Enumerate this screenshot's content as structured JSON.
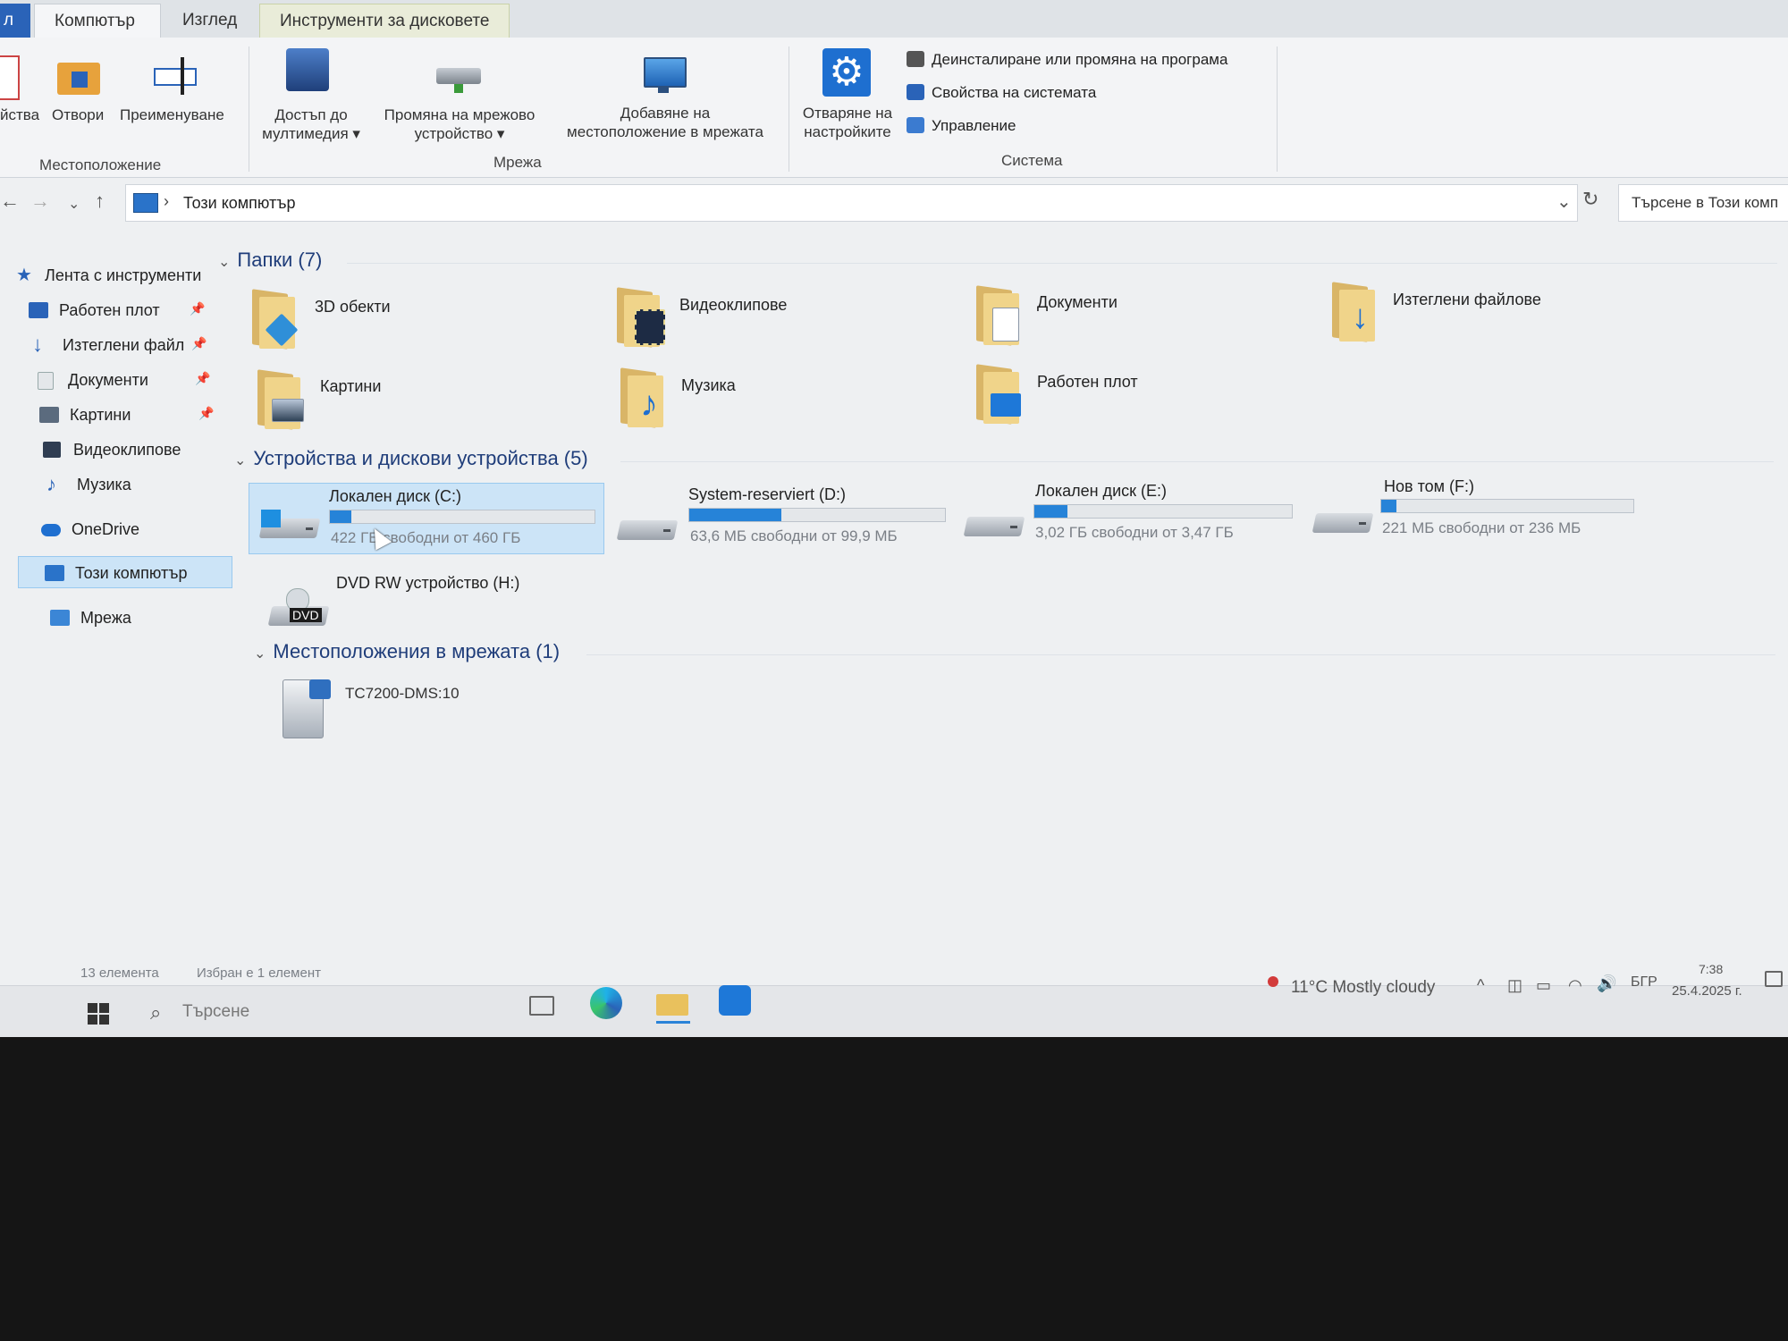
{
  "ribbon": {
    "tabs": [
      "л",
      "Компютър",
      "Изглед",
      "Инструменти за дисковете"
    ],
    "location": {
      "properties_label": "йства",
      "open_label": "Отвори",
      "rename_label": "Преименуване",
      "group_label": "Местоположение"
    },
    "network": {
      "media_label_1": "Достъп до",
      "media_label_2": "мултимедия ▾",
      "map_drive_label_1": "Промяна на мрежово",
      "map_drive_label_2": "устройство ▾",
      "add_location_label_1": "Добавяне на",
      "add_location_label_2": "местоположение в мрежата",
      "group_label": "Мрежа"
    },
    "system": {
      "settings_label_1": "Отваряне на",
      "settings_label_2": "настройките",
      "uninstall_label": "Деинсталиране или промяна на програма",
      "sysprops_label": "Свойства на системата",
      "manage_label": "Управление",
      "group_label": "Система"
    }
  },
  "address": {
    "path": "Този компютър",
    "separator": "›",
    "search_placeholder": "Търсене в Този комп"
  },
  "sidebar": {
    "quick_access": "Лента с инструменти",
    "items": [
      {
        "label": "Работен плот",
        "pinned": true
      },
      {
        "label": "Изтеглени файл",
        "pinned": true
      },
      {
        "label": "Документи",
        "pinned": true
      },
      {
        "label": "Картини",
        "pinned": true
      },
      {
        "label": "Видеоклипове",
        "pinned": false
      },
      {
        "label": "Музика",
        "pinned": false
      }
    ],
    "onedrive": "OneDrive",
    "this_pc": "Този компютър",
    "network": "Мрежа"
  },
  "sections": {
    "folders": "Папки (7)",
    "devices": "Устройства и дискови устройства (5)",
    "network": "Местоположения в мрежата (1)"
  },
  "folders": [
    "3D обекти",
    "Видеоклипове",
    "Документи",
    "Изтеглени файлове",
    "Картини",
    "Музика",
    "Работен плот"
  ],
  "drives": [
    {
      "name": "Локален диск (C:)",
      "free": "422 ГБ свободни от 460 ГБ",
      "used_fraction": 0.08
    },
    {
      "name": "System-reserviert (D:)",
      "free": "63,6 МБ свободни от 99,9 МБ",
      "used_fraction": 0.36
    },
    {
      "name": "Локален диск (E:)",
      "free": "3,02 ГБ свободни от 3,47 ГБ",
      "used_fraction": 0.13
    },
    {
      "name": "Нов том (F:)",
      "free": "221 МБ свободни от 236 МБ",
      "used_fraction": 0.06
    },
    {
      "name": "DVD RW устройство (H:)"
    }
  ],
  "dvd_badge": "DVD",
  "network_locations": [
    "TC7200-DMS:10"
  ],
  "status": {
    "count": "13 елемента",
    "selected": "Избран е 1 елемент"
  },
  "taskbar": {
    "search_placeholder": "Търсене",
    "weather": "11°C  Mostly cloudy",
    "lang": "БГР",
    "time": "7:38",
    "date": "25.4.2025 г."
  },
  "colors": {
    "accent": "#2683d8",
    "selection": "#cce4f7",
    "folder": "#f0d48a"
  }
}
